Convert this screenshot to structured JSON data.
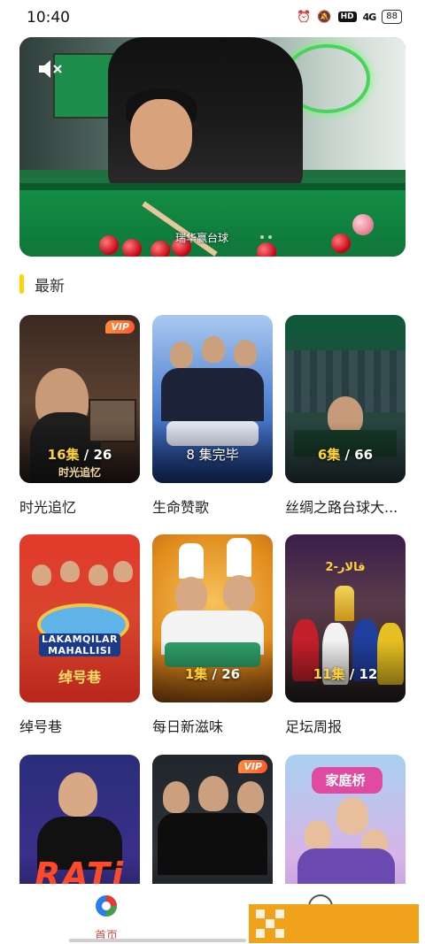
{
  "status_bar": {
    "time": "10:40",
    "hd": "HD",
    "network": "4G",
    "battery": "88"
  },
  "banner": {
    "caption": "瑞华赢台球",
    "mute_icon": "speaker-mute-icon"
  },
  "section": {
    "title": "最新"
  },
  "cards": [
    {
      "title": "时光追忆",
      "ep_current": "16",
      "ep_unit": "集",
      "ep_total": "/ 26",
      "vip": "VIP",
      "poster_text": "时光追忆"
    },
    {
      "title": "生命赞歌",
      "ep_plain": "8 集完毕"
    },
    {
      "title": "丝绸之路台球大...",
      "ep_current": "6",
      "ep_unit": "集",
      "ep_total": "/ 66"
    },
    {
      "title": "绰号巷",
      "poster_text": "LAKAMQILAR MAHALLISI",
      "poster_cn": "绰号巷"
    },
    {
      "title": "每日新滋味",
      "ep_current": "1",
      "ep_unit": "集",
      "ep_total": "/ 26"
    },
    {
      "title": "足坛周报",
      "ep_current": "11",
      "ep_unit": "集",
      "ep_total": "/ 12",
      "poster_sub": "2-قالار"
    },
    {
      "title": "",
      "poster_text": "RATi"
    },
    {
      "title": "",
      "vip": "VIP"
    },
    {
      "title": "",
      "poster_cn": "家庭桥"
    }
  ],
  "tabbar": {
    "home_label": "首页",
    "home_icon": "app-logo-icon",
    "other_icon": "profile-icon"
  },
  "colors": {
    "accent": "#ffd400",
    "active_tab": "#e0453a",
    "episode_highlight": "#ffd23a"
  }
}
